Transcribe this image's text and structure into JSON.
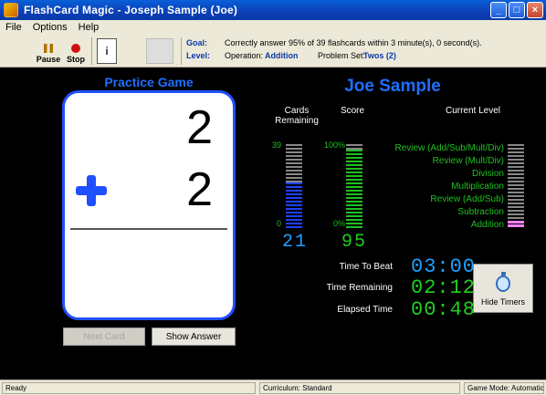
{
  "window": {
    "title": "FlashCard Magic - Joseph  Sample (Joe)"
  },
  "menu": [
    "File",
    "Options",
    "Help"
  ],
  "toolbar": {
    "pause_label": "Pause",
    "stop_label": "Stop",
    "help_label": "i"
  },
  "info": {
    "goal_label": "Goal:",
    "goal_text": "Correctly answer 95% of 39 flashcards within 3 minute(s), 0 second(s).",
    "level_label": "Level:",
    "operation_label": "Operation:",
    "operation_value": "Addition",
    "problem_set_label": "Problem Set:",
    "problem_set_value": "Twos (2)"
  },
  "card": {
    "heading": "Practice Game",
    "top_number": "2",
    "bottom_number": "2",
    "operator_icon": "plus-icon"
  },
  "buttons": {
    "next_card": "Next Card",
    "show_answer": "Show Answer"
  },
  "student": {
    "name": "Joe Sample"
  },
  "cards_remaining": {
    "heading_line1": "Cards",
    "heading_line2": "Remaining",
    "max_label": "39",
    "min_label": "0",
    "value": "21",
    "fraction": 0.54
  },
  "score": {
    "heading": "Score",
    "max_label": "100%",
    "min_label": "0%",
    "value": "95",
    "fraction": 0.95
  },
  "current_level": {
    "heading": "Current Level",
    "levels": [
      "Review (Add/Sub/Mult/Div)",
      "Review (Mult/Div)",
      "Division",
      "Multiplication",
      "Review (Add/Sub)",
      "Subtraction",
      "Addition"
    ],
    "active_level": "Addition"
  },
  "timers": {
    "time_to_beat_label": "Time To Beat",
    "time_to_beat": "03:00",
    "time_remaining_label": "Time Remaining",
    "time_remaining": "02:12",
    "elapsed_label": "Elapsed Time",
    "elapsed": "00:48",
    "hide_timers_label": "Hide Timers"
  },
  "status": {
    "left": "Ready",
    "curriculum": "Curriculum: Standard",
    "game_mode": "Game Mode: Automatic"
  },
  "colors": {
    "blue_accent": "#1e6fff",
    "bar_blue": "#2040ff",
    "bar_green": "#20c020",
    "digit_cyan": "#1ea0ff",
    "digit_green": "#20d020",
    "active_level": "#ff80ff"
  }
}
